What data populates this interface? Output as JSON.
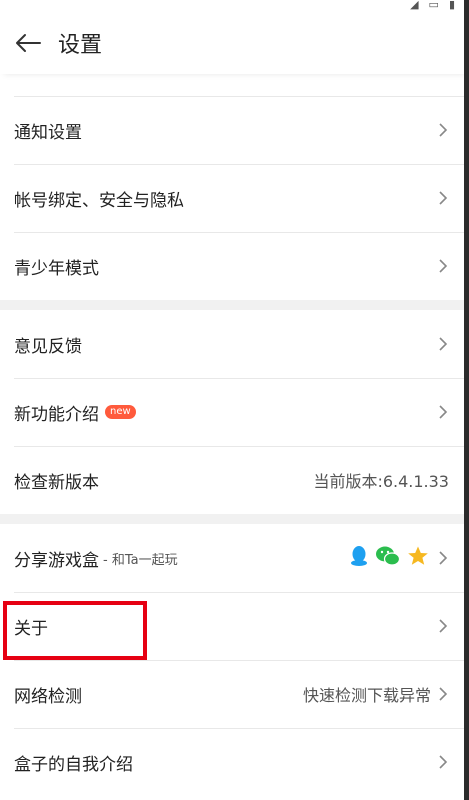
{
  "status_bar": {
    "icons": [
      "signal-icon",
      "battery-icon"
    ],
    "time": ""
  },
  "header": {
    "title": "设置"
  },
  "groups": [
    {
      "items": [
        {
          "label": "通知设置"
        },
        {
          "label": "帐号绑定、安全与隐私"
        },
        {
          "label": "青少年模式"
        }
      ]
    },
    {
      "items": [
        {
          "label": "意见反馈"
        },
        {
          "label": "新功能介绍",
          "badge": "new"
        },
        {
          "label": "检查新版本",
          "value": "当前版本:6.4.1.33"
        }
      ]
    },
    {
      "items": [
        {
          "label": "分享游戏盒",
          "sublabel": "- 和Ta一起玩",
          "share_icons": [
            "qq-icon",
            "wechat-icon",
            "qzone-star-icon"
          ]
        },
        {
          "label": "关于"
        },
        {
          "label": "网络检测",
          "value": "快速检测下载异常"
        },
        {
          "label": "盒子的自我介绍"
        }
      ]
    }
  ],
  "colors": {
    "badge": "#ff5a3c",
    "highlight": "#e60012",
    "qq": "#1ea0f0",
    "wechat": "#2bbd4e",
    "star": "#f6b820"
  }
}
